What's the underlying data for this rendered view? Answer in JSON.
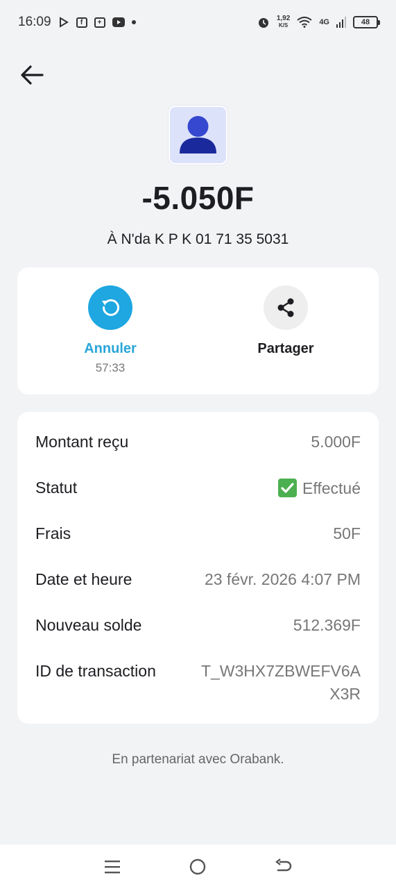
{
  "status_bar": {
    "time": "16:09",
    "net_speed_value": "1,92",
    "net_speed_unit": "K/S",
    "network_type": "4G",
    "battery": "48"
  },
  "transaction": {
    "amount": "-5.050F",
    "recipient": "À N'da K P K 01 71 35 5031"
  },
  "actions": {
    "cancel_label": "Annuler",
    "cancel_timer": "57:33",
    "share_label": "Partager"
  },
  "details": {
    "amount_received_label": "Montant reçu",
    "amount_received_value": "5.000F",
    "status_label": "Statut",
    "status_value": "Effectué",
    "fees_label": "Frais",
    "fees_value": "50F",
    "datetime_label": "Date et heure",
    "datetime_value": "23 févr. 2026 4:07 PM",
    "new_balance_label": "Nouveau solde",
    "new_balance_value": "512.369F",
    "transaction_id_label": "ID de transaction",
    "transaction_id_value": "T_W3HX7ZBWEFV6AX3R"
  },
  "footer": {
    "partner_text": "En partenariat avec Orabank."
  },
  "colors": {
    "accent": "#1ea7e1",
    "accent_text": "#2aa5d8",
    "avatar_bg": "#dde2fb",
    "avatar_fg": "#1a2a9c",
    "success": "#4caf50",
    "background": "#f2f3f5"
  }
}
